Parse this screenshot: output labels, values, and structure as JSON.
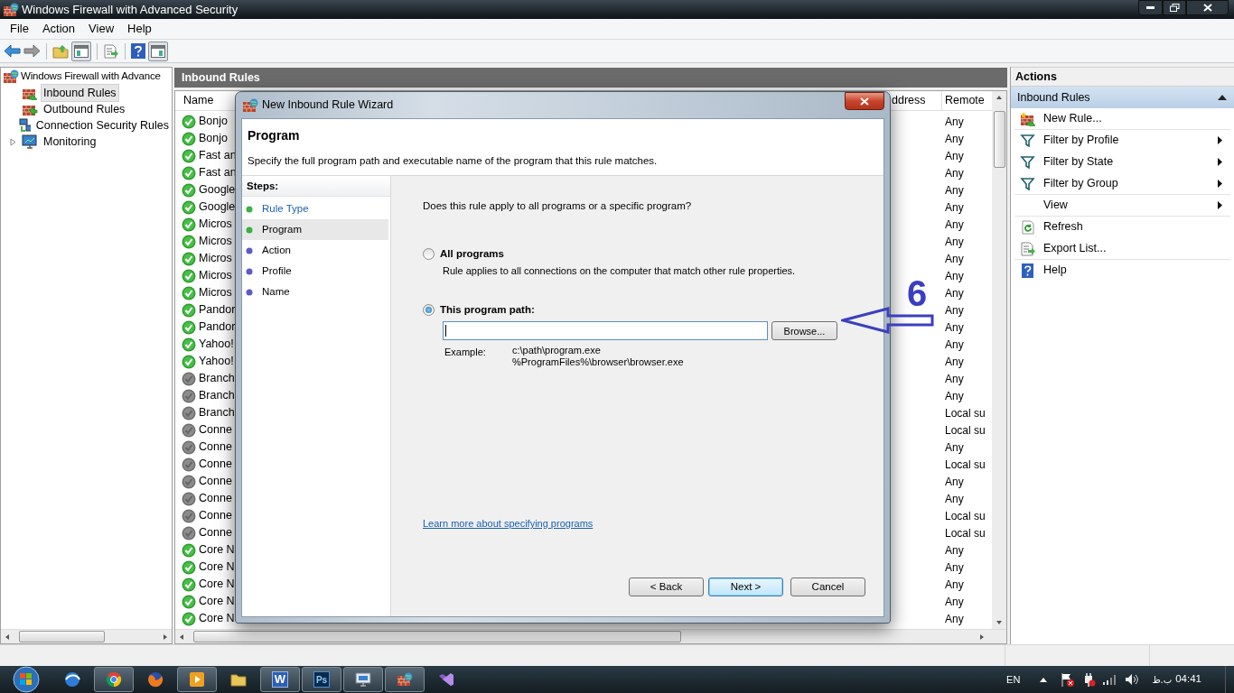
{
  "window": {
    "title": "Windows Firewall with Advanced Security"
  },
  "menu": [
    "File",
    "Action",
    "View",
    "Help"
  ],
  "tree": {
    "label": "Windows Firewall with Advance",
    "children": [
      {
        "label": "Inbound Rules",
        "kind": "inbound",
        "selected": true
      },
      {
        "label": "Outbound Rules",
        "kind": "outbound",
        "selected": false
      },
      {
        "label": "Connection Security Rules",
        "kind": "connection",
        "selected": false
      },
      {
        "label": "Monitoring",
        "kind": "monitor",
        "selected": false,
        "expanded": false
      }
    ]
  },
  "center": {
    "title": "Inbound Rules",
    "columns": [
      "Name",
      "ddress",
      "Remote"
    ],
    "rows": [
      {
        "name": "Bonjo",
        "enabled": true,
        "remote": "Any"
      },
      {
        "name": "Bonjo",
        "enabled": true,
        "remote": "Any"
      },
      {
        "name": "Fast an",
        "enabled": true,
        "remote": "Any"
      },
      {
        "name": "Fast an",
        "enabled": true,
        "remote": "Any"
      },
      {
        "name": "Google",
        "enabled": true,
        "remote": "Any"
      },
      {
        "name": "Google",
        "enabled": true,
        "remote": "Any"
      },
      {
        "name": "Micros",
        "enabled": true,
        "remote": "Any"
      },
      {
        "name": "Micros",
        "enabled": true,
        "remote": "Any"
      },
      {
        "name": "Micros",
        "enabled": true,
        "remote": "Any"
      },
      {
        "name": "Micros",
        "enabled": true,
        "remote": "Any"
      },
      {
        "name": "Micros",
        "enabled": true,
        "remote": "Any"
      },
      {
        "name": "Pandor",
        "enabled": true,
        "remote": "Any"
      },
      {
        "name": "Pandor",
        "enabled": true,
        "remote": "Any"
      },
      {
        "name": "Yahoo!",
        "enabled": true,
        "remote": "Any"
      },
      {
        "name": "Yahoo!",
        "enabled": true,
        "remote": "Any"
      },
      {
        "name": "Branch",
        "enabled": false,
        "remote": "Any"
      },
      {
        "name": "Branch",
        "enabled": false,
        "remote": "Any"
      },
      {
        "name": "Branch",
        "enabled": false,
        "remote": "Local su"
      },
      {
        "name": "Conne",
        "enabled": false,
        "remote": "Local su"
      },
      {
        "name": "Conne",
        "enabled": false,
        "remote": "Any"
      },
      {
        "name": "Conne",
        "enabled": false,
        "remote": "Local su"
      },
      {
        "name": "Conne",
        "enabled": false,
        "remote": "Any"
      },
      {
        "name": "Conne",
        "enabled": false,
        "remote": "Any"
      },
      {
        "name": "Conne",
        "enabled": false,
        "remote": "Local su"
      },
      {
        "name": "Conne",
        "enabled": false,
        "remote": "Local su"
      },
      {
        "name": "Core N",
        "enabled": true,
        "remote": "Any"
      },
      {
        "name": "Core N",
        "enabled": true,
        "remote": "Any"
      },
      {
        "name": "Core N",
        "enabled": true,
        "remote": "Any"
      },
      {
        "name": "Core N",
        "enabled": true,
        "remote": "Any"
      },
      {
        "name": "Core N",
        "enabled": true,
        "remote": "Any"
      }
    ]
  },
  "dialog": {
    "title": "New Inbound Rule Wizard",
    "heading": "Program",
    "description": "Specify the full program path and executable name of the program that this rule matches.",
    "steps_title": "Steps:",
    "steps": [
      {
        "label": "Rule Type",
        "kind": "link",
        "color": "#3cb043",
        "selected": false
      },
      {
        "label": "Program",
        "kind": "plain",
        "color": "#3cb043",
        "selected": true
      },
      {
        "label": "Action",
        "kind": "plain",
        "color": "#5b5bc8",
        "selected": false
      },
      {
        "label": "Profile",
        "kind": "plain",
        "color": "#5b5bc8",
        "selected": false
      },
      {
        "label": "Name",
        "kind": "plain",
        "color": "#5b5bc8",
        "selected": false
      }
    ],
    "question": "Does this rule apply to all programs or a specific program?",
    "options": [
      {
        "label": "All programs",
        "description": "Rule applies to all connections on the computer that match other rule properties.",
        "selected": false
      },
      {
        "label": "This program path:",
        "selected": true
      }
    ],
    "browse_button": "Browse...",
    "example_label": "Example:",
    "examples": [
      "c:\\path\\program.exe",
      "%ProgramFiles%\\browser\\browser.exe"
    ],
    "link": "Learn more about specifying programs",
    "buttons": [
      {
        "label": "< Back",
        "default": false
      },
      {
        "label": "Next >",
        "default": true
      },
      {
        "label": "Cancel",
        "default": false
      }
    ]
  },
  "annotation": {
    "label": "6"
  },
  "actions": {
    "title": "Actions",
    "section": "Inbound Rules",
    "items": [
      {
        "label": "New Rule...",
        "kind": "new",
        "submenu": false,
        "divider_after": true
      },
      {
        "label": "Filter by Profile",
        "kind": "filter",
        "submenu": true,
        "divider_after": false
      },
      {
        "label": "Filter by State",
        "kind": "filter",
        "submenu": true,
        "divider_after": false
      },
      {
        "label": "Filter by Group",
        "kind": "filter",
        "submenu": true,
        "divider_after": true
      },
      {
        "label": "View",
        "kind": "none",
        "submenu": true,
        "divider_after": true
      },
      {
        "label": "Refresh",
        "kind": "refresh",
        "submenu": false,
        "divider_after": false
      },
      {
        "label": "Export List...",
        "kind": "export",
        "submenu": false,
        "divider_after": true
      },
      {
        "label": "Help",
        "kind": "help",
        "submenu": false,
        "divider_after": false
      }
    ]
  },
  "taskbar": {
    "apps": [
      {
        "kind": "ie",
        "active": false
      },
      {
        "kind": "chrome",
        "active": true
      },
      {
        "kind": "firefox",
        "active": false
      },
      {
        "kind": "media",
        "active": true
      },
      {
        "kind": "folder",
        "active": false
      },
      {
        "kind": "word",
        "label": "W",
        "active": true
      },
      {
        "kind": "photoshop",
        "label": "Ps",
        "active": true
      },
      {
        "kind": "remote",
        "active": true
      },
      {
        "kind": "firewall",
        "active": true
      },
      {
        "kind": "vs",
        "active": false
      }
    ],
    "language": "EN",
    "time": "04:41",
    "period": "ب.ظ"
  }
}
